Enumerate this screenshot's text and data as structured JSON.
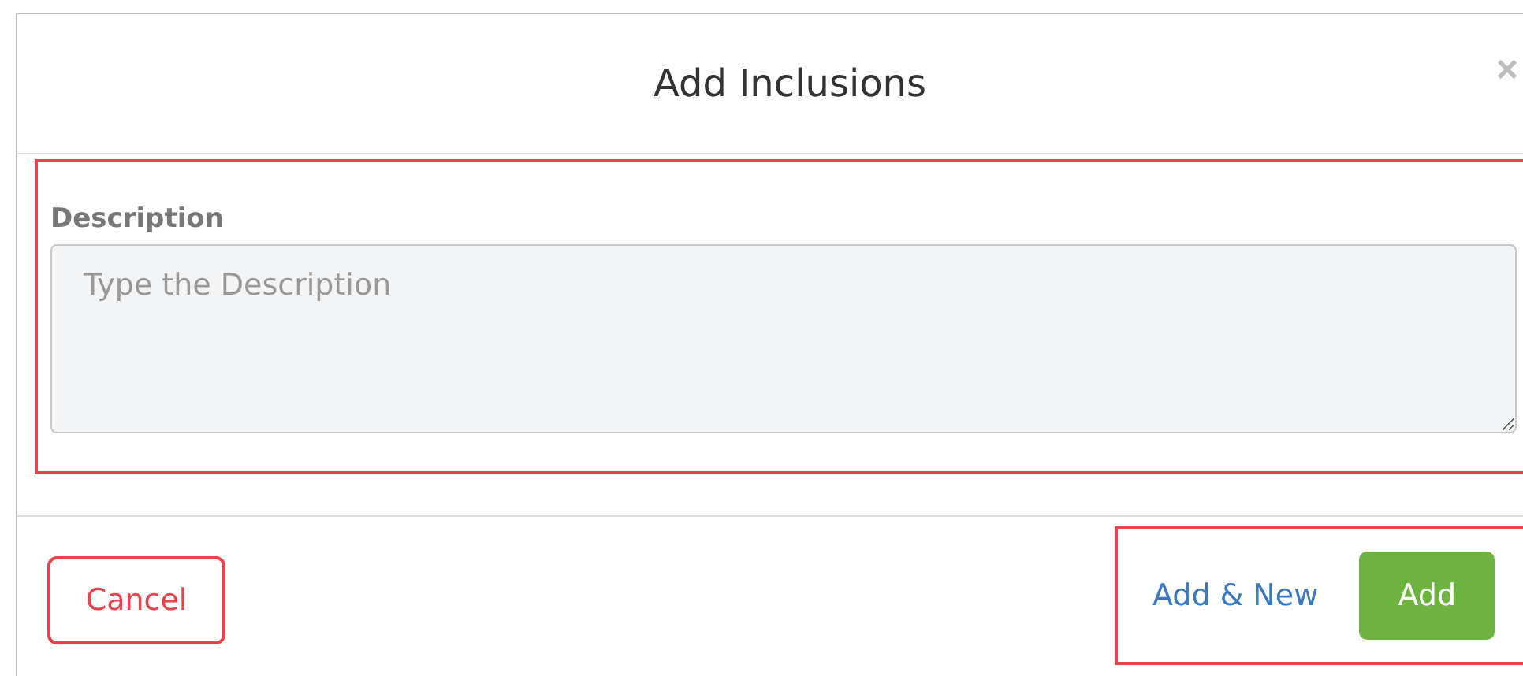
{
  "dialog": {
    "title": "Add Inclusions",
    "close": "×"
  },
  "description": {
    "label": "Description",
    "placeholder": "Type the Description",
    "highlighted": true
  },
  "footer": {
    "cancel": "Cancel",
    "add_new": "Add & New",
    "add": "Add",
    "highlighted": true
  }
}
